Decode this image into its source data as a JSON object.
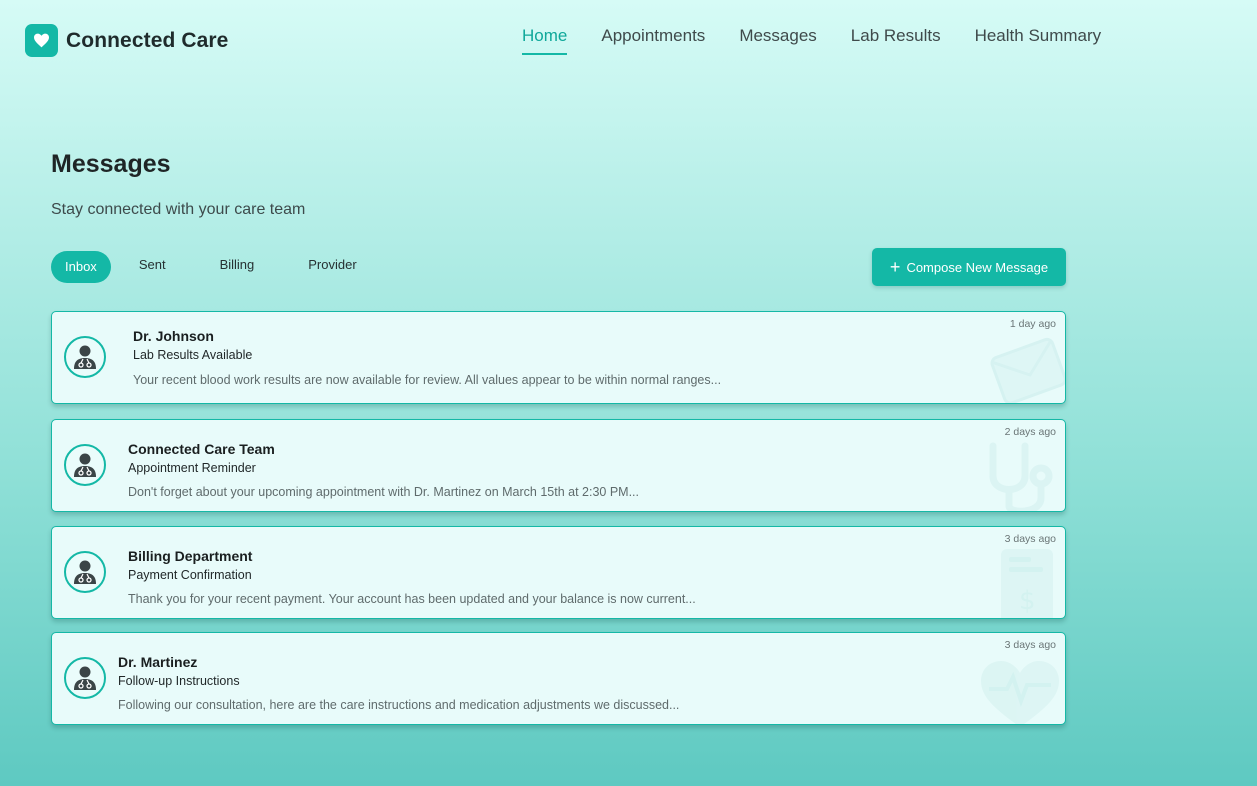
{
  "app": {
    "name": "Connected Care",
    "logo_icon": "heart-icon"
  },
  "nav": {
    "items": [
      {
        "label": "Home",
        "active": true
      },
      {
        "label": "Appointments",
        "active": false
      },
      {
        "label": "Messages",
        "active": false
      },
      {
        "label": "Lab Results",
        "active": false
      },
      {
        "label": "Health Summary",
        "active": false
      }
    ]
  },
  "page": {
    "title": "Messages",
    "subtitle": "Stay connected with your care team"
  },
  "tabs": [
    {
      "label": "Inbox",
      "active": true
    },
    {
      "label": "Sent",
      "active": false
    },
    {
      "label": "Billing",
      "active": false
    },
    {
      "label": "Provider",
      "active": false
    }
  ],
  "compose": {
    "label": "Compose New Message",
    "icon": "plus-icon"
  },
  "messages": [
    {
      "from": "Dr. Johnson",
      "subject": "Lab Results Available",
      "preview": "Your recent blood work results are now available for review. All values appear to be within normal ranges...",
      "time": "1 day ago",
      "watermark_icon": "envelope-icon"
    },
    {
      "from": "Connected Care Team",
      "subject": "Appointment Reminder",
      "preview": "Don't forget about your upcoming appointment with Dr. Martinez on March 15th at 2:30 PM...",
      "time": "2 days ago",
      "watermark_icon": "stethoscope-icon"
    },
    {
      "from": "Billing Department",
      "subject": "Payment Confirmation",
      "preview": "Thank you for your recent payment. Your account has been updated and your balance is now current...",
      "time": "3 days ago",
      "watermark_icon": "invoice-icon"
    },
    {
      "from": "Dr. Martinez",
      "subject": "Follow-up Instructions",
      "preview": "Following our consultation, here are the care instructions and medication adjustments we discussed...",
      "time": "3 days ago",
      "watermark_icon": "heartbeat-icon"
    }
  ],
  "colors": {
    "accent": "#14b8a6",
    "card_bg": "#e8fbfa",
    "text_dark": "#1f2526"
  }
}
